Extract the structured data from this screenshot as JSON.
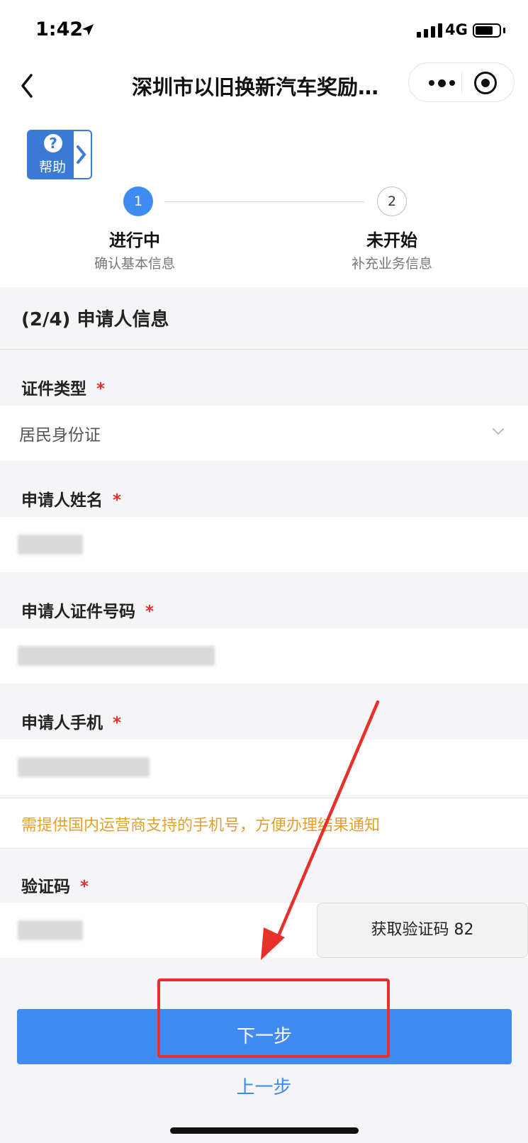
{
  "status_bar": {
    "time": "1:42",
    "network": "4G"
  },
  "nav": {
    "title": "深圳市以旧换新汽车奖励…"
  },
  "help": {
    "label": "帮助",
    "glyph": "?"
  },
  "steps": [
    {
      "number": "1",
      "status": "进行中",
      "desc": "确认基本信息"
    },
    {
      "number": "2",
      "status": "未开始",
      "desc": "补充业务信息"
    }
  ],
  "section": {
    "title": "(2/4)  申请人信息"
  },
  "fields": {
    "id_type": {
      "label": "证件类型",
      "required": "*",
      "value": "居民身份证"
    },
    "name": {
      "label": "申请人姓名",
      "required": "*"
    },
    "id_number": {
      "label": "申请人证件号码",
      "required": "*"
    },
    "phone": {
      "label": "申请人手机",
      "required": "*"
    },
    "code": {
      "label": "验证码",
      "required": "*",
      "button_label": "获取验证码 82"
    }
  },
  "notice": "需提供国内运营商支持的手机号，方便办理结果通知",
  "buttons": {
    "next": "下一步",
    "prev": "上一步"
  },
  "colors": {
    "primary": "#3f8bf0",
    "required": "#e0312b",
    "notice": "#e3a02f",
    "annotation": "#e8302b"
  }
}
